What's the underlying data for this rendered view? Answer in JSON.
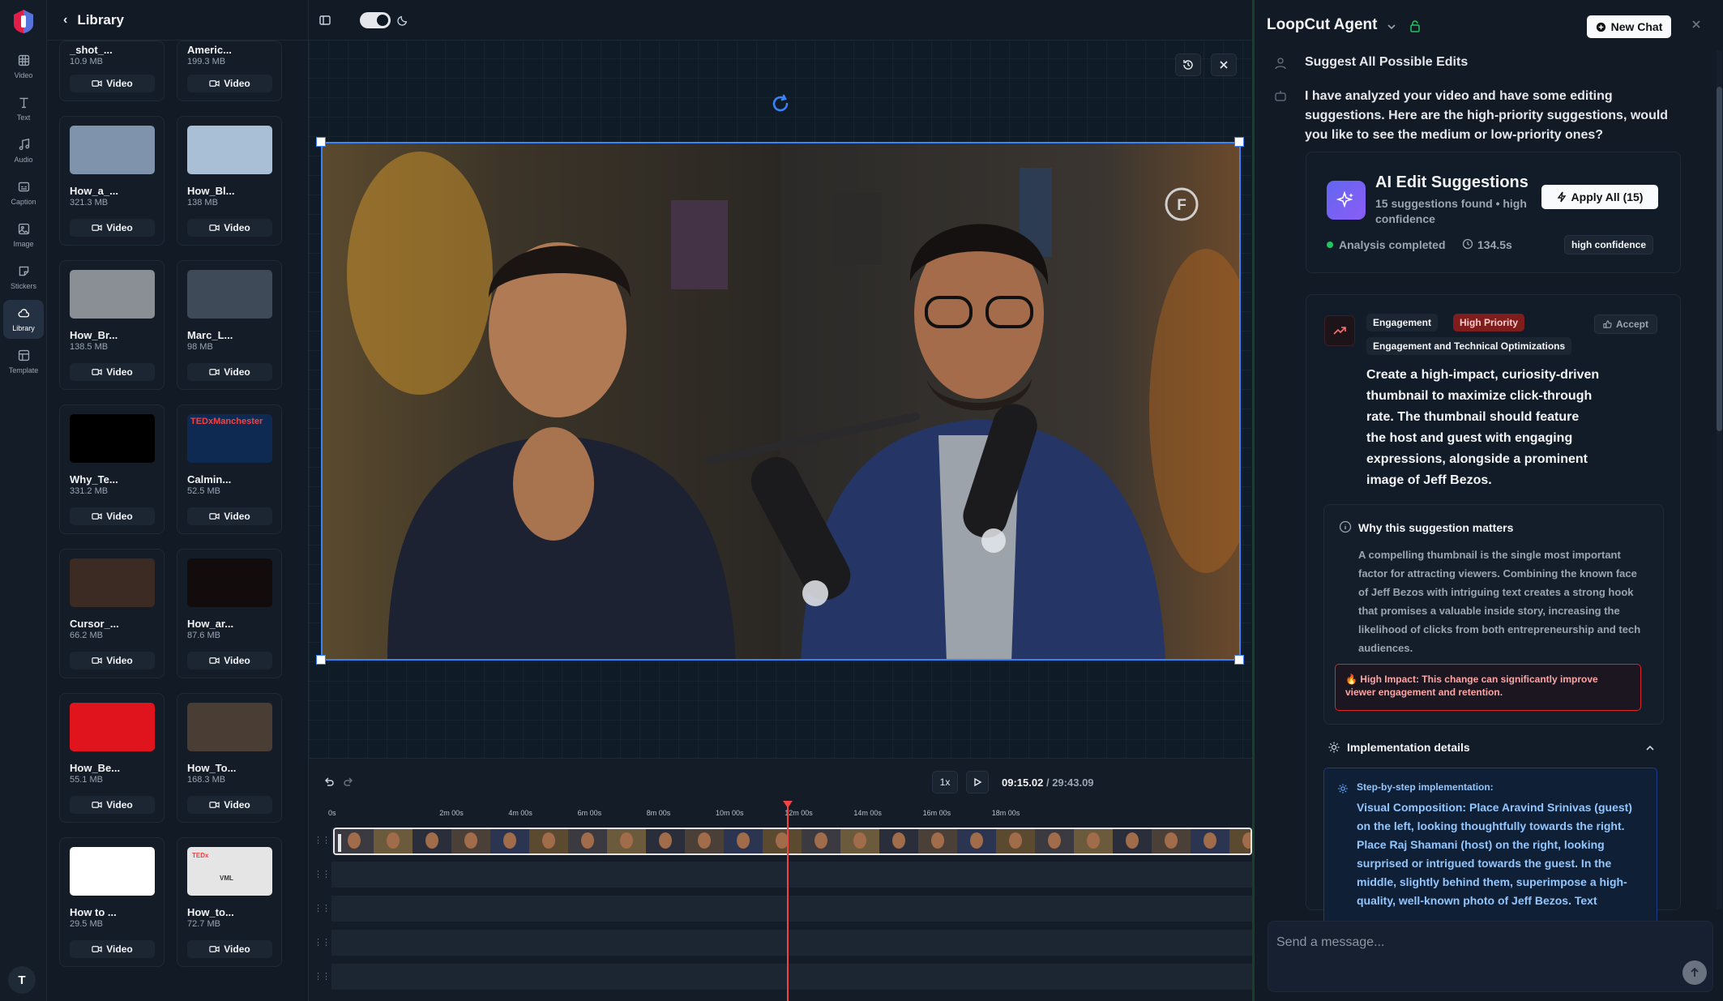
{
  "rail": {
    "items": [
      {
        "label": "Video",
        "icon": "film-icon"
      },
      {
        "label": "Text",
        "icon": "text-icon"
      },
      {
        "label": "Audio",
        "icon": "music-icon"
      },
      {
        "label": "Caption",
        "icon": "caption-icon"
      },
      {
        "label": "Image",
        "icon": "image-icon"
      },
      {
        "label": "Stickers",
        "icon": "sticker-icon"
      },
      {
        "label": "Library",
        "icon": "cloud-icon"
      },
      {
        "label": "Template",
        "icon": "template-icon"
      }
    ],
    "user_initial": "T"
  },
  "library": {
    "title": "Library",
    "items": [
      {
        "name": "_shot_...",
        "size": "10.9 MB",
        "type": "Video",
        "thumb_color": "#2a3445"
      },
      {
        "name": "Americ...",
        "size": "199.3 MB",
        "type": "Video",
        "thumb_color": "#2a3445"
      },
      {
        "name": "How_a_...",
        "size": "321.3 MB",
        "type": "Video",
        "thumb_color": "#7f93ad"
      },
      {
        "name": "How_Bl...",
        "size": "138 MB",
        "type": "Video",
        "thumb_color": "#a9bfd6"
      },
      {
        "name": "How_Br...",
        "size": "138.5 MB",
        "type": "Video",
        "thumb_color": "#8a8f95"
      },
      {
        "name": "Marc_L...",
        "size": "98 MB",
        "type": "Video",
        "thumb_color": "#3f4a58"
      },
      {
        "name": "Why_Te...",
        "size": "331.2 MB",
        "type": "Video",
        "thumb_color": "#000000"
      },
      {
        "name": "Calmin...",
        "size": "52.5 MB",
        "type": "Video",
        "thumb_color": "#0e2a52"
      },
      {
        "name": "Cursor_...",
        "size": "66.2 MB",
        "type": "Video",
        "thumb_color": "#3b2b22"
      },
      {
        "name": "How_ar...",
        "size": "87.6 MB",
        "type": "Video",
        "thumb_color": "#120d0c"
      },
      {
        "name": "How_Be...",
        "size": "55.1 MB",
        "type": "Video",
        "thumb_color": "#e0141c"
      },
      {
        "name": "How_To...",
        "size": "168.3 MB",
        "type": "Video",
        "thumb_color": "#4a3d33"
      },
      {
        "name": "How to ...",
        "size": "29.5 MB",
        "type": "Video",
        "thumb_color": "#ffffff"
      },
      {
        "name": "How_to...",
        "size": "72.7 MB",
        "type": "Video",
        "thumb_color": "#e5e5e5"
      }
    ],
    "ted_label": "TEDxManchester",
    "tedx_small": "TEDx",
    "vml": "VML"
  },
  "timeline": {
    "speed": "1x",
    "current_time": "09:15.02",
    "separator": "/",
    "total_time": "29:43.09",
    "ticks": [
      "0s",
      "2m 00s",
      "4m 00s",
      "6m 00s",
      "8m 00s",
      "10m 00s",
      "12m 00s",
      "14m 00s",
      "16m 00s",
      "18m 00s"
    ],
    "playhead_fraction": 0.311
  },
  "agent": {
    "title": "LoopCut Agent",
    "new_chat": "New Chat",
    "user_message": "Suggest All Possible Edits",
    "assistant_message": "I have analyzed your video and have some editing suggestions. Here are the high-priority suggestions, would you like to see the medium or low-priority ones?",
    "summary": {
      "title": "AI Edit Suggestions",
      "subtitle": "15 suggestions found • high confidence",
      "apply_all": "Apply All (15)",
      "status": "Analysis completed",
      "duration": "134.5s",
      "confidence": "high confidence"
    },
    "suggestion": {
      "category": "Engagement",
      "priority": "High Priority",
      "group": "Engagement and Technical Optimizations",
      "accept": "Accept",
      "text": "Create a high-impact, curiosity-driven thumbnail to maximize click-through rate. The thumbnail should feature the host and guest with engaging expressions, alongside a prominent image of Jeff Bezos.",
      "why_title": "Why this suggestion matters",
      "why_text": "A compelling thumbnail is the single most important factor for attracting viewers. Combining the known face of Jeff Bezos with intriguing text creates a strong hook that promises a valuable inside story, increasing the likelihood of clicks from both entrepreneurship and tech audiences.",
      "impact": "🔥 High Impact: This change can significantly improve viewer engagement and retention.",
      "impl_title": "Implementation details",
      "impl_heading": "Step-by-step implementation:",
      "impl_text": "Visual Composition: Place Aravind Srinivas (guest) on the left, looking thoughtfully towards the right. Place Raj Shamani (host) on the right, looking surprised or intrigued towards the guest. In the middle, slightly behind them, superimpose a high-quality, well-known photo of Jeff Bezos. Text"
    },
    "composer_placeholder": "Send a message..."
  },
  "colors": {
    "accent": "#3b82f6",
    "danger": "#ef4444",
    "success": "#22c55e",
    "impl_text": "#93c5fd"
  }
}
